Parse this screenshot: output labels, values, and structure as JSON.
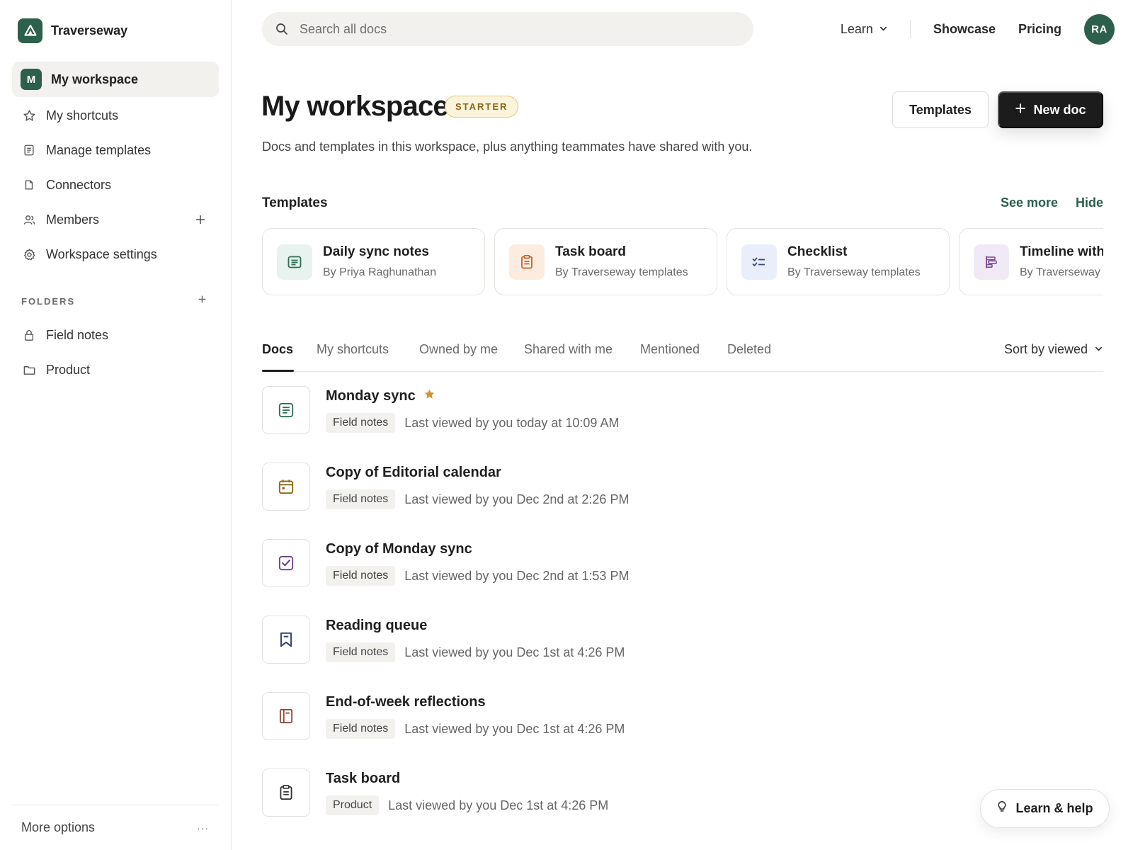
{
  "brand": {
    "name": "Traverseway"
  },
  "sidebar": {
    "workspace_initial": "M",
    "items": [
      {
        "label": "My workspace",
        "icon": "workspace-badge"
      },
      {
        "label": "My shortcuts",
        "icon": "star-icon"
      },
      {
        "label": "Manage templates",
        "icon": "document-icon"
      },
      {
        "label": "Connectors",
        "icon": "connector-icon"
      },
      {
        "label": "Members",
        "icon": "members-icon"
      },
      {
        "label": "Workspace settings",
        "icon": "gear-icon"
      }
    ],
    "folders_label": "FOLDERS",
    "folders": [
      {
        "label": "Field notes",
        "icon": "lock-icon"
      },
      {
        "label": "Product",
        "icon": "folder-icon"
      }
    ],
    "footer": {
      "label": "More options",
      "dots": "···"
    }
  },
  "topbar": {
    "search_placeholder": "Search all docs",
    "learn_label": "Learn",
    "showcase_label": "Showcase",
    "pricing_label": "Pricing",
    "avatar_initials": "RA"
  },
  "header": {
    "title": "My workspace",
    "plan_badge": "STARTER",
    "templates_button": "Templates",
    "new_doc_button": "New doc",
    "subtitle": "Docs and templates in this workspace, plus anything teammates have shared with you."
  },
  "templates": {
    "heading": "Templates",
    "see_more": "See more",
    "hide": "Hide",
    "cards": [
      {
        "name": "Daily sync notes",
        "author": "By Priya Raghunathan",
        "icon": "notes-icon",
        "accent": "#2c6e56",
        "bg": "#e8f2ee"
      },
      {
        "name": "Task board",
        "author": "By Traverseway templates",
        "icon": "clipboard-icon",
        "accent": "#c0622a",
        "bg": "#fcece0"
      },
      {
        "name": "Checklist",
        "author": "By Traverseway templates",
        "icon": "checklist-icon",
        "accent": "#3a4a7a",
        "bg": "#eaeefa"
      },
      {
        "name": "Timeline with",
        "author": "By Traverseway",
        "icon": "timeline-icon",
        "accent": "#7b4f96",
        "bg": "#f1eaf6"
      }
    ]
  },
  "tabs": {
    "items": [
      "Docs",
      "My shortcuts",
      "Owned by me",
      "Shared with me",
      "Mentioned",
      "Deleted"
    ],
    "active": "Docs",
    "sort_label": "Sort by viewed"
  },
  "docs": [
    {
      "title": "Monday sync",
      "starred": true,
      "tag": "Field notes",
      "viewed": "Last viewed by you today at 10:09 AM",
      "icon": "notes-icon",
      "icon_color": "#2c6e56"
    },
    {
      "title": "Copy of Editorial calendar",
      "starred": false,
      "tag": "Field notes",
      "viewed": "Last viewed by you Dec 2nd at 2:26 PM",
      "icon": "calendar-icon",
      "icon_color": "#8a6414"
    },
    {
      "title": "Copy of Monday sync",
      "starred": false,
      "tag": "Field notes",
      "viewed": "Last viewed by you Dec 2nd at 1:53 PM",
      "icon": "checkbox-icon",
      "icon_color": "#6b3f86"
    },
    {
      "title": "Reading queue",
      "starred": false,
      "tag": "Field notes",
      "viewed": "Last viewed by you Dec 1st at 4:26 PM",
      "icon": "bookmark-icon",
      "icon_color": "#2f3f7a"
    },
    {
      "title": "End-of-week reflections",
      "starred": false,
      "tag": "Field notes",
      "viewed": "Last viewed by you Dec 1st at 4:26 PM",
      "icon": "journal-icon",
      "icon_color": "#8a4a3a"
    },
    {
      "title": "Task board",
      "starred": false,
      "tag": "Product",
      "viewed": "Last viewed by you Dec 1st at 4:26 PM",
      "icon": "clipboard-icon",
      "icon_color": "#333333"
    }
  ],
  "help": {
    "label": "Learn & help"
  },
  "colors": {
    "brand": "#2c5f4c",
    "star": "#d4922a",
    "primary_button": "#1c1c1c"
  }
}
